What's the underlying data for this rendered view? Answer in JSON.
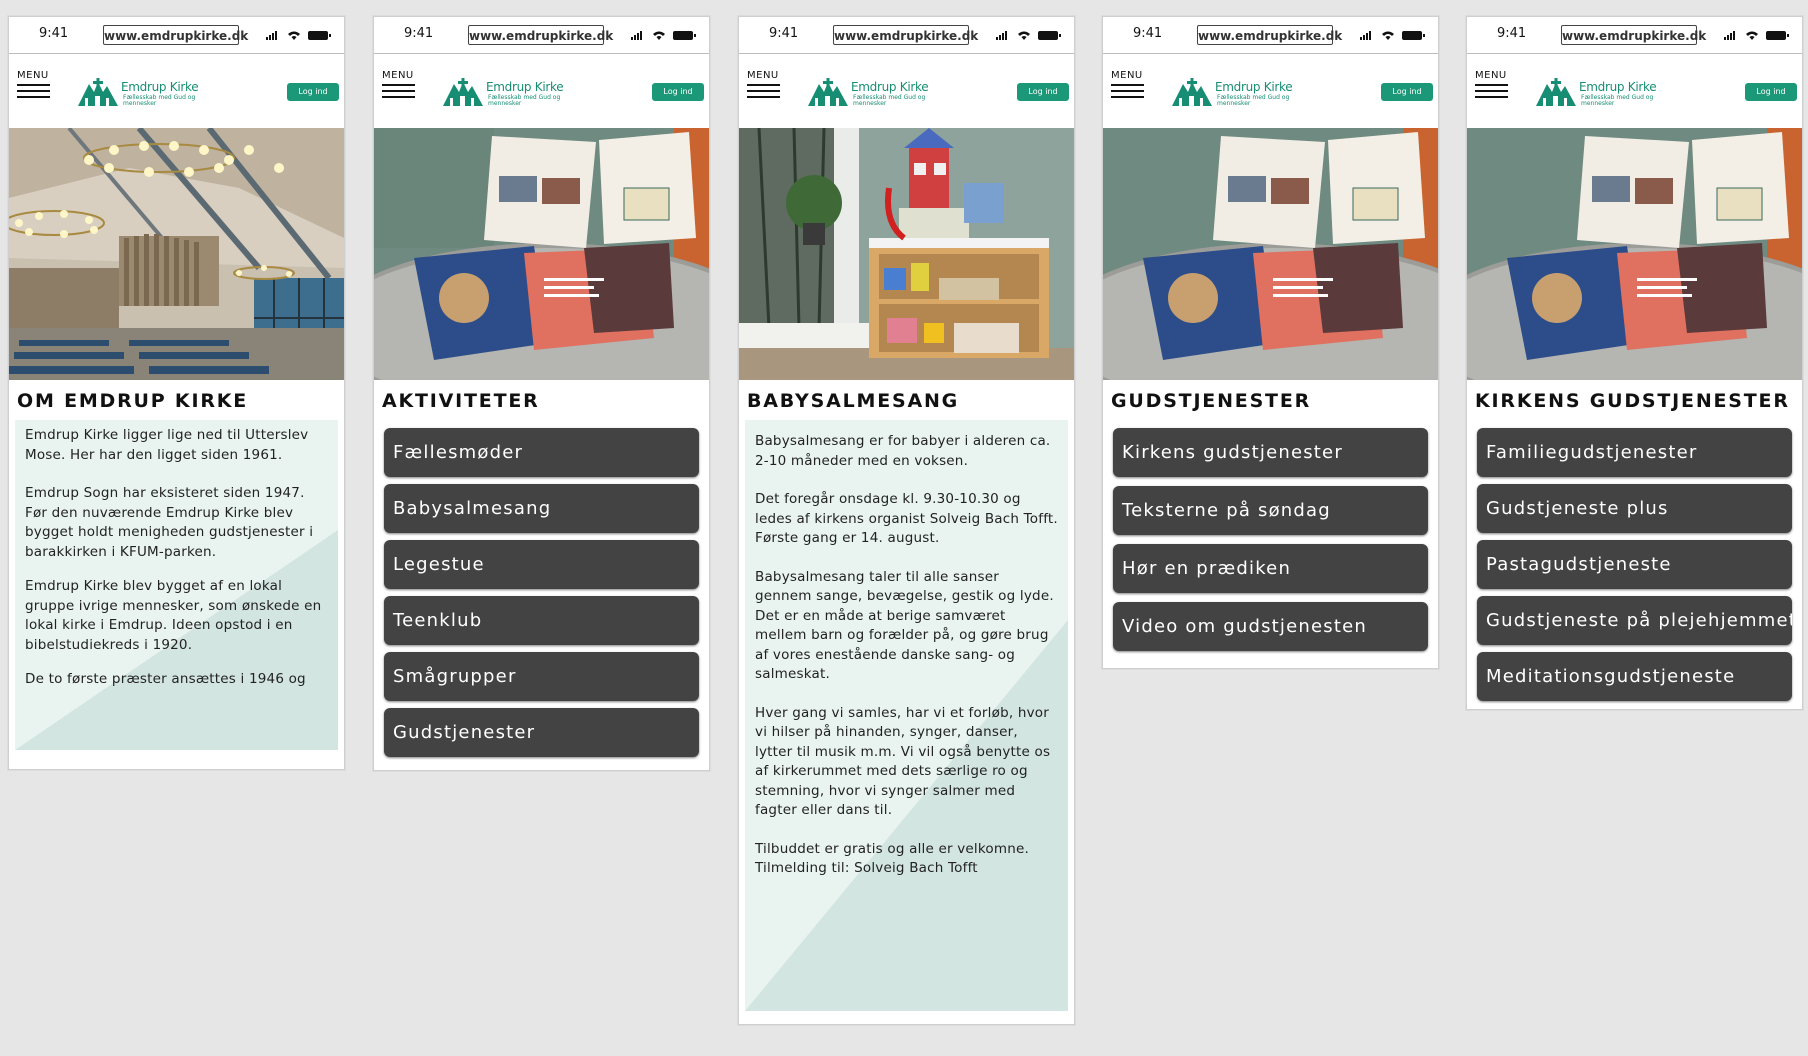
{
  "status_bar": {
    "time": "9:41",
    "url": "www.emdrupkirke.dk"
  },
  "header": {
    "menu_label": "MENU",
    "logo_title": "Emdrup Kirke",
    "logo_subtitle": "Fællesskab med Gud og mennesker",
    "login_label": "Log ind",
    "brand_color": "#1b9877"
  },
  "screens": [
    {
      "title": "OM EMDRUP KIRKE",
      "hero": "church-interior",
      "paragraphs": [
        "Emdrup Kirke ligger lige ned til Utterslev Mose. Her har den ligget siden 1961.",
        "Emdrup Sogn har eksisteret siden 1947. Før den nuværende Emdrup Kirke blev bygget holdt menigheden gudstjenester i barakkirken i KFUM-parken.",
        "Emdrup Kirke blev bygget af en lokal gruppe ivrige mennesker, som ønskede en lokal kirke i Emdrup. Ideen opstod i en bibelstudiekreds i 1920.",
        "De to første præster ansættes i 1946 og"
      ]
    },
    {
      "title": "AKTIVITETER",
      "hero": "magazines-table",
      "buttons": [
        "Fællesmøder",
        "Babysalmesang",
        "Legestue",
        "Teenklub",
        "Smågrupper",
        "Gudstjenester"
      ]
    },
    {
      "title": "BABYSALMESANG",
      "hero": "toy-shelf",
      "paragraphs": [
        "Babysalmesang er for babyer i alderen ca. 2-10 måneder med en voksen.",
        "Det foregår onsdage kl. 9.30-10.30 og ledes af kirkens organist Solveig Bach Tofft. Første gang er 14. august.",
        "Babysalmesang taler til alle sanser gennem sange, bevægelse, gestik og lyde. Det er en måde at  berige samværet mellem barn og forælder på, og gøre brug af vores enestående danske sang- og salmeskat.",
        "Hver gang vi samles, har vi et forløb, hvor vi hilser på hinanden, synger, danser, lytter til musik m.m. Vi vil også benytte os af kirkerummet med dets særlige ro og stemning, hvor vi synger salmer med fagter eller dans til.",
        "Tilbuddet er gratis og alle er velkomne. Tilmelding til:   Solveig Bach Tofft"
      ]
    },
    {
      "title": "GUDSTJENESTER",
      "hero": "magazines-table",
      "buttons": [
        "Kirkens gudstjenester",
        "Teksterne på søndag",
        "Hør en prædiken",
        "Video om gudstjenesten"
      ]
    },
    {
      "title": "KIRKENS GUDSTJENESTER",
      "hero": "magazines-table",
      "buttons": [
        "Familiegudstjenester",
        "Gudstjeneste plus",
        "Pastagudstjeneste",
        "Gudstjeneste på plejehjemmet",
        "Meditationsgudstjeneste"
      ]
    }
  ]
}
